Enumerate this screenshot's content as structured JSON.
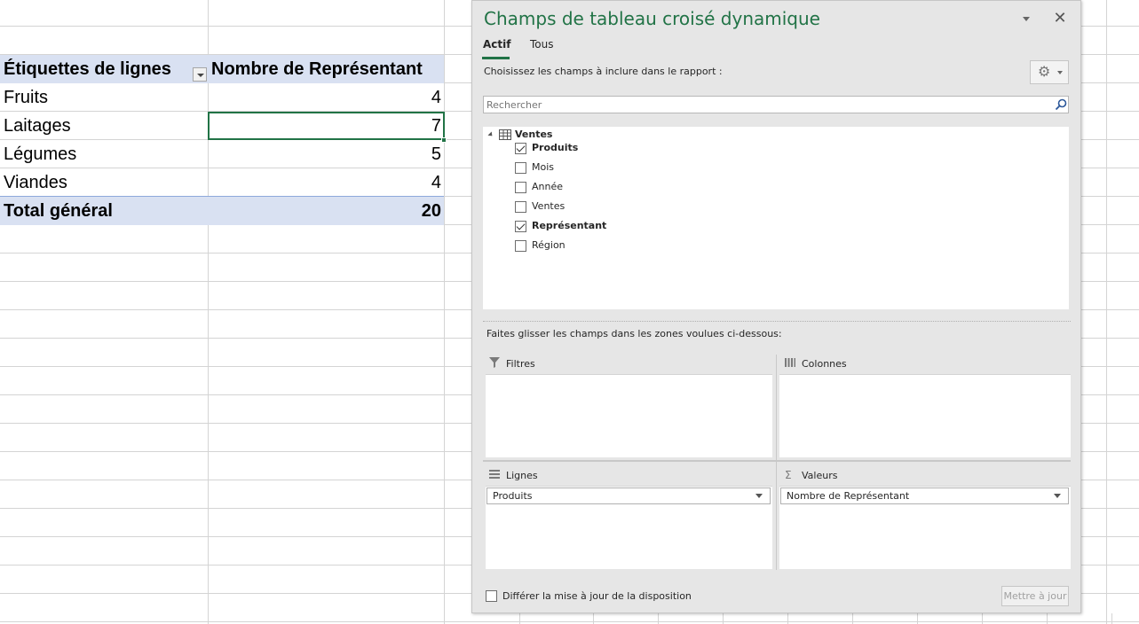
{
  "pivot_table": {
    "header_label": "Étiquettes de lignes",
    "header_value": "Nombre de Représentant",
    "rows": [
      {
        "label": "Fruits",
        "value": "4"
      },
      {
        "label": "Laitages",
        "value": "7"
      },
      {
        "label": "Légumes",
        "value": "5"
      },
      {
        "label": "Viandes",
        "value": "4"
      }
    ],
    "total_label": "Total général",
    "total_value": "20"
  },
  "pane": {
    "title": "Champs de tableau croisé dynamique",
    "close_glyph": "✕",
    "tabs": {
      "active": "Actif",
      "other": "Tous"
    },
    "choose_label": "Choisissez les champs à inclure dans le rapport :",
    "search_placeholder": "Rechercher",
    "table_name": "Ventes",
    "fields": [
      {
        "label": "Produits",
        "checked": true
      },
      {
        "label": "Mois",
        "checked": false
      },
      {
        "label": "Année",
        "checked": false
      },
      {
        "label": "Ventes",
        "checked": false
      },
      {
        "label": "Représentant",
        "checked": true
      },
      {
        "label": "Région",
        "checked": false
      }
    ],
    "drag_label": "Faites glisser les champs dans les zones voulues ci-dessous:",
    "zones": {
      "filters": "Filtres",
      "columns": "Colonnes",
      "rows": "Lignes",
      "values": "Valeurs",
      "rows_item": "Produits",
      "values_item": "Nombre de Représentant"
    },
    "defer_label": "Différer la mise à jour de la disposition",
    "update_button": "Mettre à jour"
  },
  "colors": {
    "accent": "#217346",
    "pivot_band": "#d9e1f2"
  },
  "icons": [
    "filter-dropdown-icon",
    "chevron-down-icon",
    "close-icon",
    "gear-icon",
    "search-icon",
    "table-icon",
    "checkbox-icon",
    "funnel-icon",
    "columns-icon",
    "rows-icon",
    "sigma-icon"
  ]
}
